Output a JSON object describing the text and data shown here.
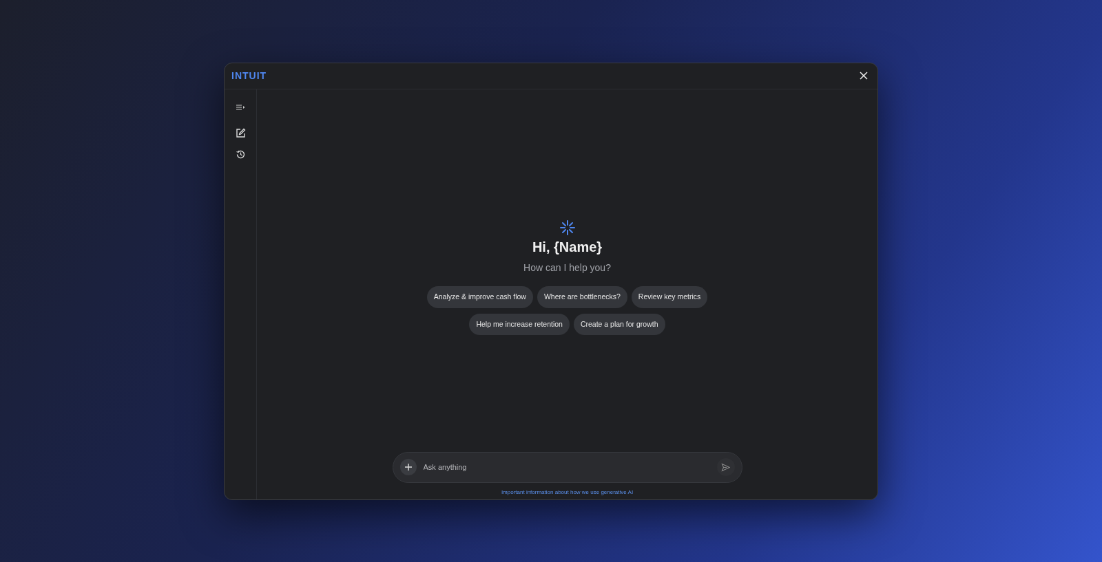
{
  "window": {
    "logo": "INTUIT"
  },
  "greeting": {
    "title": "Hi, {Name}",
    "subtitle": "How can I help you?"
  },
  "suggestions": [
    {
      "label": "Analyze & improve cash flow"
    },
    {
      "label": "Where are bottlenecks?"
    },
    {
      "label": "Review key metrics"
    },
    {
      "label": "Help me increase retention"
    },
    {
      "label": "Create a plan for growth"
    }
  ],
  "composer": {
    "placeholder": "Ask anything"
  },
  "footer_link": "Important information about how we use generative AI"
}
